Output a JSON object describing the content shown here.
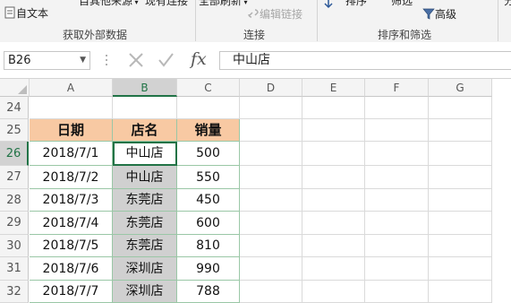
{
  "ribbon": {
    "from_text": "自文本",
    "other_sources": "自其他来源",
    "existing_connections": "现有连接",
    "refresh_all": "全部刷新",
    "edit_links": "编辑链接",
    "sort": "排序",
    "filter": "筛选",
    "advanced": "高级",
    "cut_right": "分",
    "groups": {
      "get_external_data": "获取外部数据",
      "connections": "连接",
      "sort_filter": "排序和筛选"
    }
  },
  "formula_bar": {
    "name_box": "B26",
    "fx": "fx",
    "value": "中山店"
  },
  "columns": [
    "A",
    "B",
    "C",
    "D",
    "E",
    "F",
    "G"
  ],
  "rows": [
    "24",
    "25",
    "26",
    "27",
    "28",
    "29",
    "30",
    "31",
    "32"
  ],
  "table": {
    "headers": [
      "日期",
      "店名",
      "销量"
    ],
    "data": [
      [
        "2018/7/1",
        "中山店",
        "500"
      ],
      [
        "2018/7/2",
        "中山店",
        "550"
      ],
      [
        "2018/7/3",
        "东莞店",
        "450"
      ],
      [
        "2018/7/4",
        "东莞店",
        "600"
      ],
      [
        "2018/7/5",
        "东莞店",
        "810"
      ],
      [
        "2018/7/6",
        "深圳店",
        "990"
      ],
      [
        "2018/7/7",
        "深圳店",
        "788"
      ]
    ]
  },
  "colors": {
    "header_fill": "#f8c9a3",
    "selected_fill": "#d0d0d0",
    "accent": "#217346"
  }
}
